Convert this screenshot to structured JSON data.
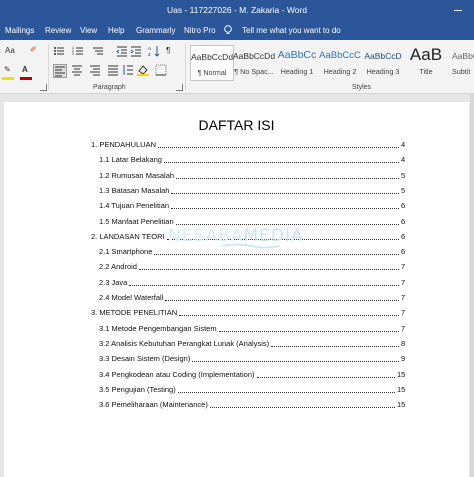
{
  "window": {
    "title": "Uas - 117227026 - M. Zakaria  -  Word"
  },
  "menu": {
    "items": [
      "Mailings",
      "Review",
      "View",
      "Help",
      "Grammarly",
      "Nitro Pro"
    ],
    "tell_me": "Tell me what you want to do"
  },
  "ribbon": {
    "paragraph_label": "Paragraph",
    "styles_label": "Styles",
    "font_row1": "Aa",
    "styles": [
      {
        "sample": "AaBbCcDd",
        "name": "¶ Normal"
      },
      {
        "sample": "AaBbCcDd",
        "name": "¶ No Spac..."
      },
      {
        "sample": "AaBbCc",
        "name": "Heading 1"
      },
      {
        "sample": "AaBbCcC",
        "name": "Heading 2"
      },
      {
        "sample": "AaBbCcD",
        "name": "Heading 3"
      },
      {
        "sample": "AaB",
        "name": "Title"
      },
      {
        "sample": "AaBbC",
        "name": "Subtit"
      }
    ]
  },
  "document": {
    "title": "DAFTAR ISI",
    "watermark": {
      "part1": "NESABA",
      "part2": "MEDIA"
    },
    "toc": [
      {
        "text": "1. PENDAHULUAN",
        "page": "4"
      },
      {
        "text": "1.1 Latar Belakang",
        "page": "4"
      },
      {
        "text": "1.2 Rumusan Masalah",
        "page": "5"
      },
      {
        "text": "1.3 Batasan Masalah",
        "page": "5"
      },
      {
        "text": "1.4 Tujuan Penelitian",
        "page": "6"
      },
      {
        "text": "1.5 Manfaat Penelitian",
        "page": "6"
      },
      {
        "text": "2. LANDASAN TEORI",
        "page": "6"
      },
      {
        "text": "2.1 Smartphone",
        "page": "6"
      },
      {
        "text": "2.2 Android",
        "page": "7"
      },
      {
        "text": "2.3 Java",
        "page": "7"
      },
      {
        "text": "2.4 Model Waterfall",
        "page": "7"
      },
      {
        "text": "3. METODE PENELITIAN",
        "page": "7"
      },
      {
        "text": "3.1 Metode Pengembangan Sistem",
        "page": "7"
      },
      {
        "text": "3.2 Analisis Kebutuhan Perangkat Lunak (Analysis)",
        "page": "8"
      },
      {
        "text": "3.3 Desain Sistem (Design)",
        "page": "9"
      },
      {
        "text": "3.4 Pengkodean atau Coding (Implementation)",
        "page": "15"
      },
      {
        "text": "3.5 Pengujian (Testing)",
        "page": "15"
      },
      {
        "text": "3.6 Pemeliharaan (Maintenance)",
        "page": "15"
      }
    ]
  },
  "colors": {
    "titlebar": "#2b579a",
    "watermark": "#cfe8f5"
  }
}
